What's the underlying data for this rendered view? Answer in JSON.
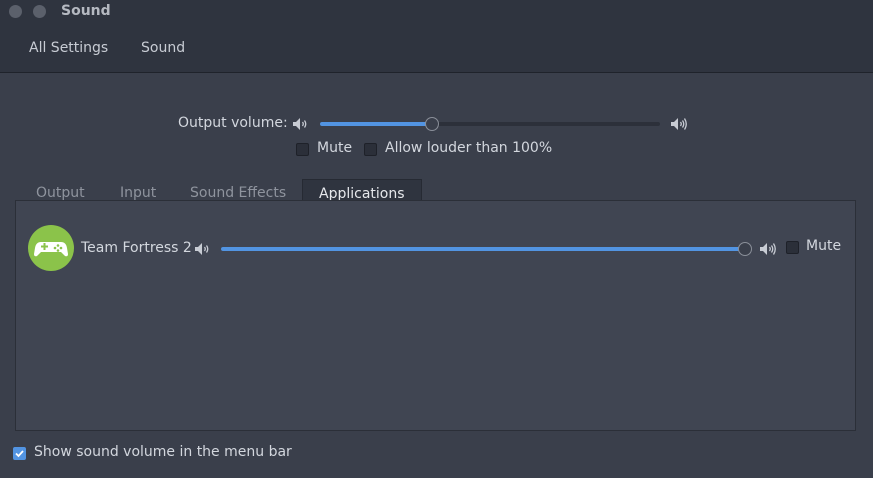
{
  "window": {
    "title": "Sound"
  },
  "nav": {
    "all_settings": "All Settings",
    "sound": "Sound"
  },
  "output": {
    "label": "Output volume:",
    "volume_percent": 33,
    "mute_label": "Mute",
    "mute_checked": false,
    "allow_louder_label": "Allow louder than 100%",
    "allow_louder_checked": false
  },
  "tabs": [
    {
      "label": "Output",
      "active": false
    },
    {
      "label": "Input",
      "active": false
    },
    {
      "label": "Sound Effects",
      "active": false
    },
    {
      "label": "Applications",
      "active": true
    }
  ],
  "applications": [
    {
      "name": "Team Fortress 2",
      "icon": "gamepad-icon",
      "volume_percent": 100,
      "mute_label": "Mute",
      "mute_checked": false
    }
  ],
  "footer": {
    "show_volume_label": "Show sound volume in the menu bar",
    "show_volume_checked": true
  },
  "colors": {
    "accent": "#5294e2",
    "app_icon_bg": "#8bc34a",
    "titlebar_bg": "#2f343f",
    "content_bg": "#3a3f4b"
  }
}
